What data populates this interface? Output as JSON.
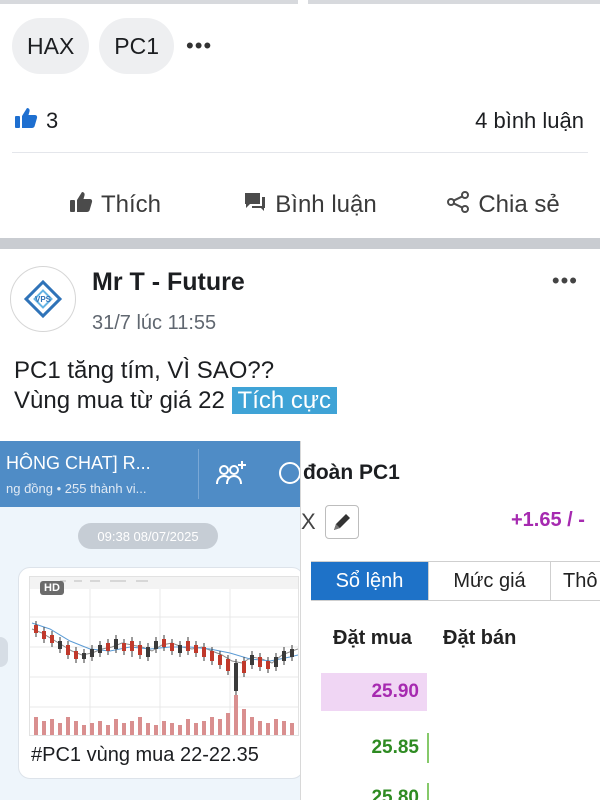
{
  "tags": [
    "HAX",
    "PC1"
  ],
  "tags_more": "•••",
  "reactions": {
    "like_count": "3",
    "comments_label": "4 bình luận"
  },
  "actions": {
    "like": "Thích",
    "comment": "Bình luận",
    "share": "Chia sẻ"
  },
  "post": {
    "author": "Mr T - Future",
    "time": "31/7 lúc 11:55",
    "more": "•••",
    "text_line1": "PC1 tăng tím, VÌ SAO??",
    "text_line2_prefix": "Vùng mua từ giá 22",
    "text_highlight": "Tích cực"
  },
  "chat_image": {
    "title": "HÔNG CHAT] R...",
    "subtitle": "ng đồng • 255 thành vi...",
    "date_pill": "09:38 08/07/2025",
    "hd_badge": "HD",
    "caption": "#PC1 vùng mua 22-22.35"
  },
  "orderbook_image": {
    "title": "đoàn PC1",
    "close_x": "X",
    "change": "+1.65 / -",
    "tabs": [
      "Sổ lệnh",
      "Mức giá",
      "Thô"
    ],
    "col_buy": "Đặt mua",
    "col_sell": "Đặt bán",
    "rows": [
      "25.90",
      "25.85",
      "25.80"
    ]
  },
  "colors": {
    "accent_blue": "#1e72c8",
    "highlight_bg": "#3fa3d6",
    "chat_header": "#4f8cc6",
    "price_purple": "#a62ab0",
    "price_green": "#2e8b22",
    "row1_bg": "#f0d6f4"
  },
  "icons": {
    "like": "thumbs-up-icon",
    "comment": "comment-icon",
    "share": "share-icon",
    "group": "group-add-icon",
    "edit": "pencil-icon",
    "avatar": "vps-logo"
  }
}
